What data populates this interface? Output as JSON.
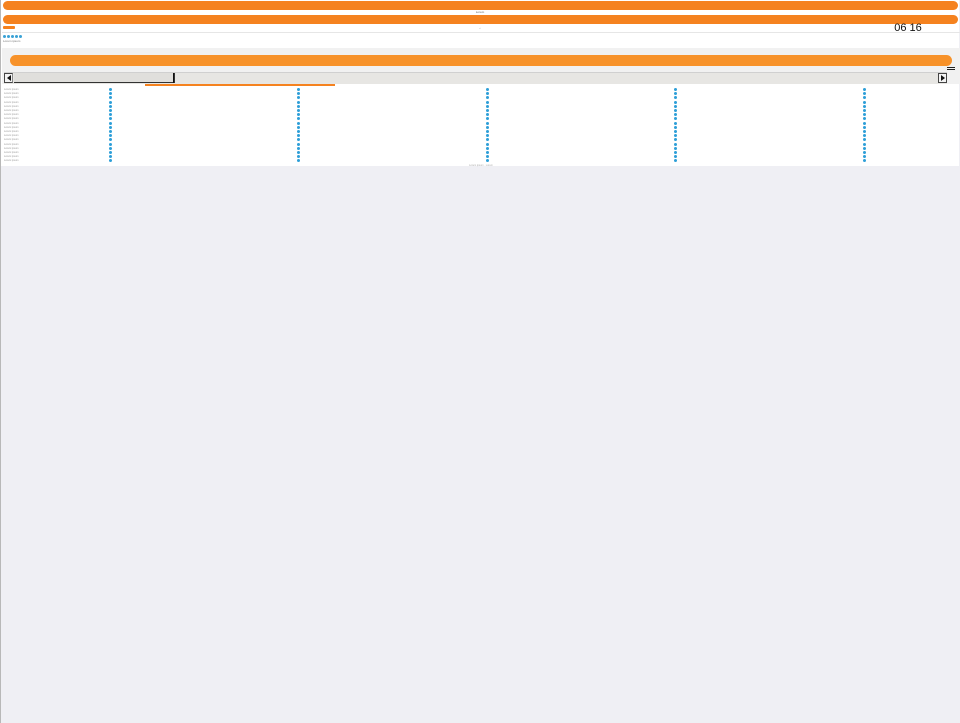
{
  "header": {
    "caption_top": "Lorem",
    "caption_second": "‹",
    "clock": "06 16"
  },
  "toolbar": {
    "dot_count": 5,
    "note": "Lorem ipsum"
  },
  "list": {
    "column_count": 5,
    "rows": [
      "Lorem ipsum",
      "Lorem ipsum",
      "Lorem ipsum",
      "Lorem ipsum",
      "Lorem ipsum",
      "Lorem ipsum",
      "Lorem ipsum",
      "Lorem ipsum",
      "Lorem ipsum",
      "Lorem ipsum",
      "Lorem ipsum",
      "Lorem ipsum",
      "Lorem ipsum",
      "Lorem ipsum",
      "Lorem ipsum",
      "Lorem ipsum",
      "Lorem ipsum",
      "Lorem ipsum"
    ],
    "footer": "Lorem ipsum · Lorem"
  },
  "colors": {
    "accent": "#f5821f",
    "dot": "#2e9fd8",
    "background": "#efeff4"
  },
  "scrollbar": {
    "position_fraction": 0.17
  }
}
